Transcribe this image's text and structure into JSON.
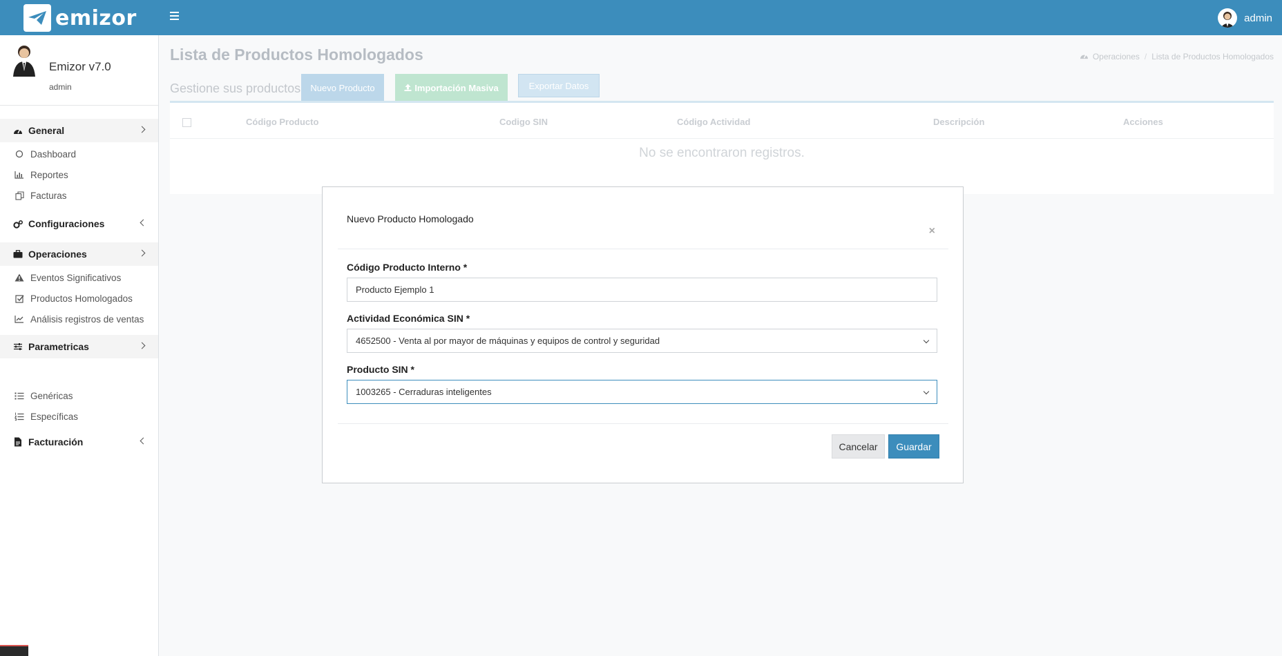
{
  "brand": {
    "name": "emizor"
  },
  "topbar": {
    "user_name": "admin"
  },
  "sidebar": {
    "user_title": "Emizor v7.0",
    "user_role": "admin",
    "groups": [
      {
        "label": "General",
        "items": [
          {
            "label": "Dashboard"
          },
          {
            "label": "Reportes"
          },
          {
            "label": "Facturas"
          }
        ]
      },
      {
        "label": "Configuraciones"
      },
      {
        "label": "Operaciones",
        "items": [
          {
            "label": "Eventos Significativos"
          },
          {
            "label": "Productos Homologados"
          },
          {
            "label": "Análisis registros de ventas"
          }
        ]
      },
      {
        "label": "Parametricas",
        "items": [
          {
            "label": "Genéricas"
          },
          {
            "label": "Específicas"
          }
        ]
      },
      {
        "label": "Facturación"
      }
    ]
  },
  "page": {
    "title": "Lista de Productos Homologados",
    "breadcrumb": [
      "Operaciones",
      "Lista de Productos Homologados"
    ],
    "toolbar_label": "Gestione sus productos",
    "buttons": {
      "new": "Nuevo Producto",
      "import": "Importación Masiva",
      "export": "Exportar Datos"
    },
    "table": {
      "columns": [
        "Código Producto",
        "Codigo SIN",
        "Código Actividad",
        "Descripción",
        "Acciones"
      ],
      "empty_message": "No se encontraron registros."
    }
  },
  "modal": {
    "title": "Nuevo Producto Homologado",
    "close_symbol": "×",
    "fields": {
      "codigo": {
        "label": "Código Producto Interno *",
        "value": "Producto Ejemplo 1"
      },
      "actividad": {
        "label": "Actividad Económica SIN *",
        "value": "4652500 - Venta al por mayor de máquinas y equipos de control y seguridad"
      },
      "producto": {
        "label": "Producto SIN *",
        "value": "1003265 - Cerraduras inteligentes"
      }
    },
    "cancel_label": "Cancelar",
    "save_label": "Guardar"
  },
  "colors": {
    "primary": "#3c8dbc",
    "success_faded": "#bfe5d0"
  }
}
